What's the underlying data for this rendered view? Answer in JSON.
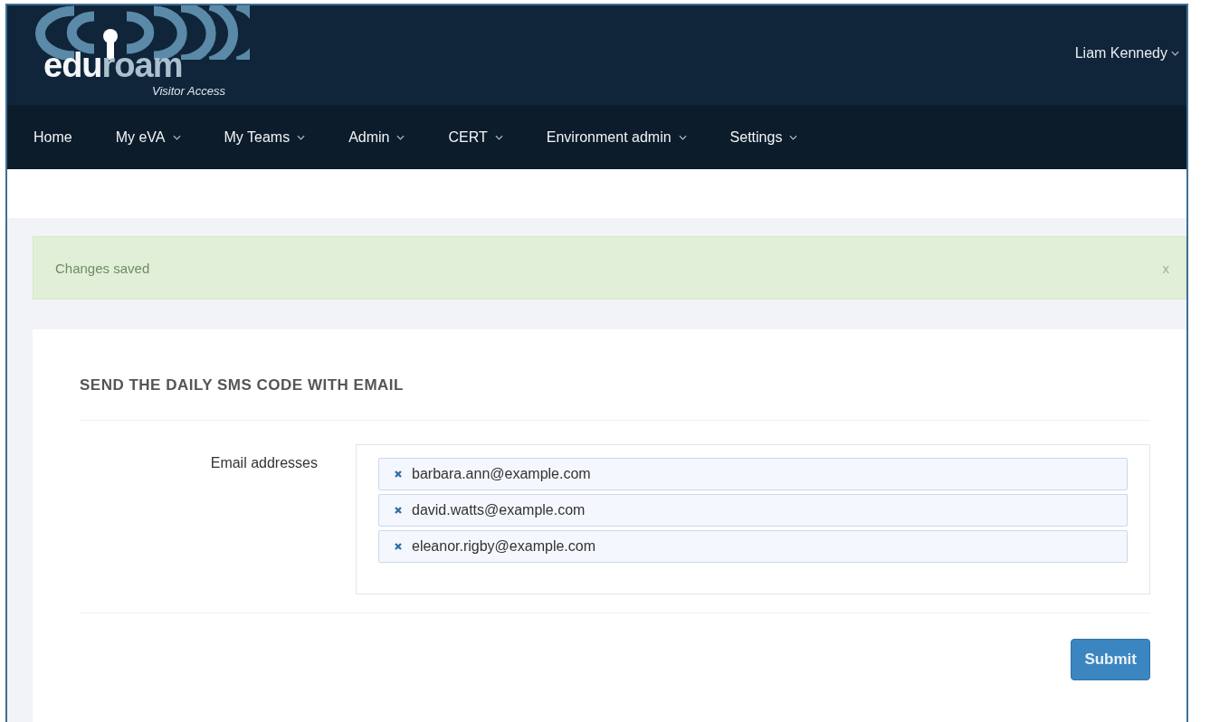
{
  "logo": {
    "part_1": "edu",
    "part_2": "roam",
    "tagline": "Visitor Access"
  },
  "user_menu": {
    "label": "Liam Kennedy",
    "has_menu": true
  },
  "nav": [
    {
      "label": "Home",
      "has_menu": false
    },
    {
      "label": "My eVA",
      "has_menu": true
    },
    {
      "label": "My Teams",
      "has_menu": true
    },
    {
      "label": "Admin",
      "has_menu": true
    },
    {
      "label": "CERT",
      "has_menu": true
    },
    {
      "label": "Environment admin",
      "has_menu": true
    },
    {
      "label": "Settings",
      "has_menu": true
    }
  ],
  "alert": {
    "message": "Changes saved",
    "close": "x"
  },
  "form": {
    "title": "SEND THE DAILY SMS CODE WITH EMAIL",
    "field_label": "Email addresses",
    "emails": [
      {
        "address": "barbara.ann@example.com"
      },
      {
        "address": "david.watts@example.com"
      },
      {
        "address": "eleanor.rigby@example.com"
      }
    ],
    "submit": "Submit"
  }
}
